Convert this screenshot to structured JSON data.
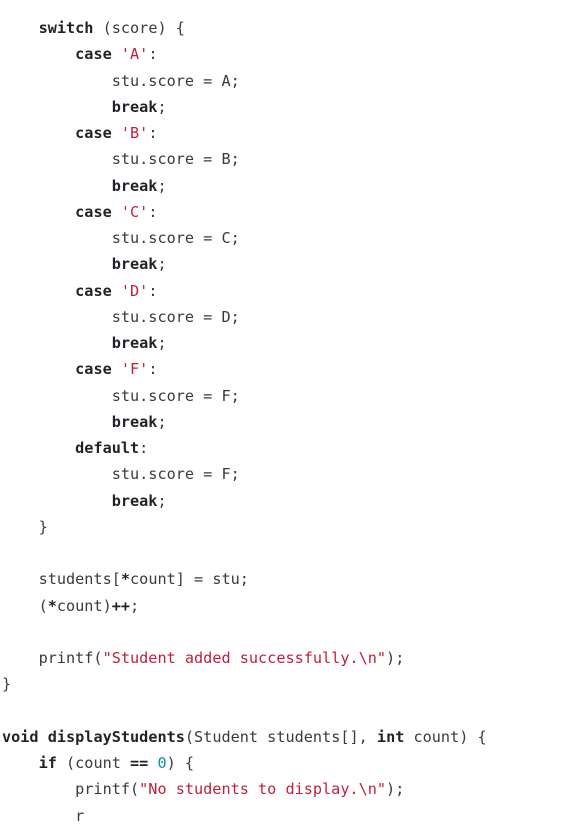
{
  "code": {
    "lines": [
      [
        {
          "t": "    "
        },
        {
          "t": "switch",
          "k": "kw"
        },
        {
          "t": " (score) {"
        }
      ],
      [
        {
          "t": "        "
        },
        {
          "t": "case",
          "k": "kw"
        },
        {
          "t": " "
        },
        {
          "t": "'A'",
          "k": "str"
        },
        {
          "t": ":"
        }
      ],
      [
        {
          "t": "            stu.score = A;"
        }
      ],
      [
        {
          "t": "            "
        },
        {
          "t": "break",
          "k": "kw"
        },
        {
          "t": ";"
        }
      ],
      [
        {
          "t": "        "
        },
        {
          "t": "case",
          "k": "kw"
        },
        {
          "t": " "
        },
        {
          "t": "'B'",
          "k": "str"
        },
        {
          "t": ":"
        }
      ],
      [
        {
          "t": "            stu.score = B;"
        }
      ],
      [
        {
          "t": "            "
        },
        {
          "t": "break",
          "k": "kw"
        },
        {
          "t": ";"
        }
      ],
      [
        {
          "t": "        "
        },
        {
          "t": "case",
          "k": "kw"
        },
        {
          "t": " "
        },
        {
          "t": "'C'",
          "k": "str"
        },
        {
          "t": ":"
        }
      ],
      [
        {
          "t": "            stu.score = C;"
        }
      ],
      [
        {
          "t": "            "
        },
        {
          "t": "break",
          "k": "kw"
        },
        {
          "t": ";"
        }
      ],
      [
        {
          "t": "        "
        },
        {
          "t": "case",
          "k": "kw"
        },
        {
          "t": " "
        },
        {
          "t": "'D'",
          "k": "str"
        },
        {
          "t": ":"
        }
      ],
      [
        {
          "t": "            stu.score = D;"
        }
      ],
      [
        {
          "t": "            "
        },
        {
          "t": "break",
          "k": "kw"
        },
        {
          "t": ";"
        }
      ],
      [
        {
          "t": "        "
        },
        {
          "t": "case",
          "k": "kw"
        },
        {
          "t": " "
        },
        {
          "t": "'F'",
          "k": "str"
        },
        {
          "t": ":"
        }
      ],
      [
        {
          "t": "            stu.score = F;"
        }
      ],
      [
        {
          "t": "            "
        },
        {
          "t": "break",
          "k": "kw"
        },
        {
          "t": ";"
        }
      ],
      [
        {
          "t": "        "
        },
        {
          "t": "default",
          "k": "kw"
        },
        {
          "t": ":"
        }
      ],
      [
        {
          "t": "            stu.score = F;"
        }
      ],
      [
        {
          "t": "            "
        },
        {
          "t": "break",
          "k": "kw"
        },
        {
          "t": ";"
        }
      ],
      [
        {
          "t": "    }"
        }
      ],
      [],
      [
        {
          "t": "    students["
        },
        {
          "t": "*",
          "k": "kw"
        },
        {
          "t": "count] = stu;"
        }
      ],
      [
        {
          "t": "    ("
        },
        {
          "t": "*",
          "k": "kw"
        },
        {
          "t": "count)"
        },
        {
          "t": "++",
          "k": "kw"
        },
        {
          "t": ";"
        }
      ],
      [],
      [
        {
          "t": "    printf("
        },
        {
          "t": "\"Student added successfully.\\n\"",
          "k": "str"
        },
        {
          "t": ");"
        }
      ],
      [
        {
          "t": "}"
        }
      ],
      [],
      [
        {
          "t": "void",
          "k": "kw"
        },
        {
          "t": " "
        },
        {
          "t": "displayStudents",
          "k": "fn"
        },
        {
          "t": "(Student students[], "
        },
        {
          "t": "int",
          "k": "kw"
        },
        {
          "t": " count) {"
        }
      ],
      [
        {
          "t": "    "
        },
        {
          "t": "if",
          "k": "kw"
        },
        {
          "t": " (count "
        },
        {
          "t": "==",
          "k": "kw"
        },
        {
          "t": " "
        },
        {
          "t": "0",
          "k": "num"
        },
        {
          "t": ") {"
        }
      ],
      [
        {
          "t": "        printf("
        },
        {
          "t": "\"No students to display.\\n\"",
          "k": "str"
        },
        {
          "t": ");"
        }
      ],
      [
        {
          "t": "        r"
        }
      ]
    ]
  },
  "colors": {
    "background": "#ffffff",
    "plain_text": "#383a42",
    "keyword": "#1f2328",
    "string": "#c01f3a",
    "number": "#0e8fb0"
  }
}
